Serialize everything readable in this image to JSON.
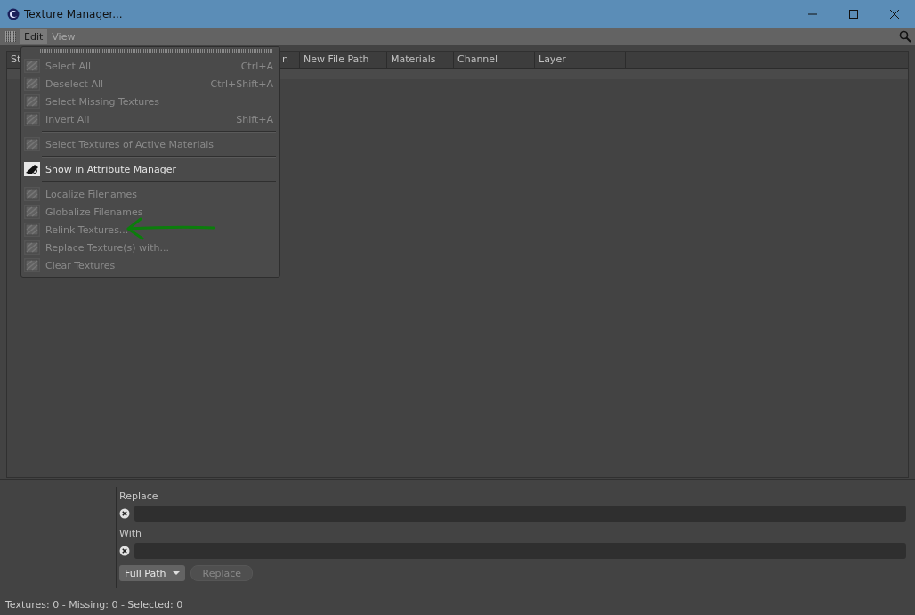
{
  "window": {
    "title": "Texture Manager..."
  },
  "menubar": [
    {
      "label": "Edit",
      "selected": true
    },
    {
      "label": "View",
      "selected": false
    }
  ],
  "table": {
    "columns": [
      "St",
      "n",
      "New File Path",
      "Materials",
      "Channel",
      "Layer"
    ]
  },
  "menu": [
    {
      "kind": "item",
      "label": "Select All",
      "shortcut": "Ctrl+A",
      "disabled": true
    },
    {
      "kind": "item",
      "label": "Deselect All",
      "shortcut": "Ctrl+Shift+A",
      "disabled": true
    },
    {
      "kind": "item",
      "label": "Select Missing Textures",
      "disabled": true
    },
    {
      "kind": "item",
      "label": "Invert All",
      "shortcut": "Shift+A",
      "disabled": true
    },
    {
      "kind": "separator"
    },
    {
      "kind": "item",
      "label": "Select Textures of Active Materials",
      "disabled": true
    },
    {
      "kind": "separator"
    },
    {
      "kind": "item",
      "label": "Show in Attribute Manager",
      "disabled": false
    },
    {
      "kind": "separator"
    },
    {
      "kind": "item",
      "label": "Localize Filenames",
      "disabled": true
    },
    {
      "kind": "item",
      "label": "Globalize Filenames",
      "disabled": true
    },
    {
      "kind": "item",
      "label": "Relink Textures...",
      "disabled": true
    },
    {
      "kind": "item",
      "label": "Replace Texture(s) with...",
      "disabled": true
    },
    {
      "kind": "item",
      "label": "Clear Textures",
      "disabled": true
    }
  ],
  "replace_panel": {
    "replace_label": "Replace",
    "with_label": "With",
    "mode": "Full Path",
    "button": {
      "label": "Replace",
      "disabled": true
    }
  },
  "status_bar": "Textures: 0 - Missing: 0 - Selected: 0"
}
